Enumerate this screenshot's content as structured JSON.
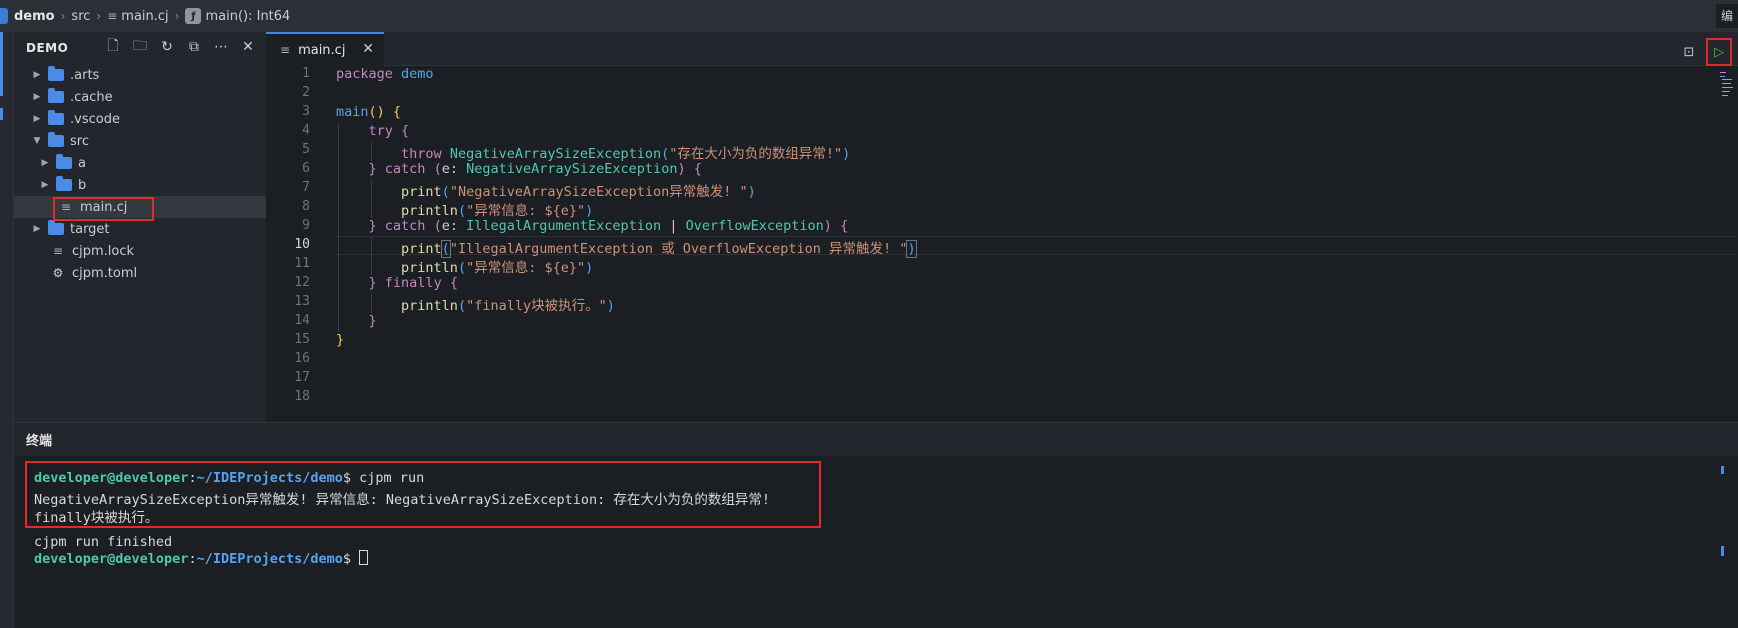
{
  "breadcrumb": {
    "project": "demo",
    "folder": "src",
    "file": "main.cj",
    "symbol": "main(): Int64",
    "right_cut": "编"
  },
  "sidebar": {
    "title": "DEMO",
    "items": [
      {
        "label": ".arts",
        "type": "folder",
        "depth": 0,
        "expanded": false
      },
      {
        "label": ".cache",
        "type": "folder",
        "depth": 0,
        "expanded": false
      },
      {
        "label": ".vscode",
        "type": "folder",
        "depth": 0,
        "expanded": false
      },
      {
        "label": "src",
        "type": "folder",
        "depth": 0,
        "expanded": true
      },
      {
        "label": "a",
        "type": "folder",
        "depth": 1,
        "expanded": false
      },
      {
        "label": "b",
        "type": "folder",
        "depth": 1,
        "expanded": false
      },
      {
        "label": "main.cj",
        "type": "file",
        "depth": 1,
        "selected": true
      },
      {
        "label": "target",
        "type": "folder",
        "depth": 0,
        "expanded": false
      },
      {
        "label": "cjpm.lock",
        "type": "file",
        "depth": 0
      },
      {
        "label": "cjpm.toml",
        "type": "config",
        "depth": 0
      }
    ]
  },
  "editor": {
    "tab_label": "main.cj",
    "active_line": 10,
    "line_numbers": [
      "1",
      "2",
      "3",
      "4",
      "5",
      "6",
      "7",
      "8",
      "9",
      "10",
      "11",
      "12",
      "13",
      "14",
      "15",
      "16",
      "17",
      "18"
    ]
  },
  "code": {
    "l1_kw": "package",
    "l1_name": "demo",
    "l3_fn": "main",
    "l4_kw": "try",
    "l5_kw": "throw",
    "l5_type": "NegativeArraySizeException",
    "l5_str": "\"存在大小为负的数组异常!\"",
    "l6_kw": "catch",
    "l6_var": "e",
    "l6_type": "NegativeArraySizeException",
    "l7_fn": "print",
    "l7_str": "\"NegativeArraySizeException异常触发! \"",
    "l8_fn": "println",
    "l8_str": "\"异常信息: ${e}\"",
    "l9_kw": "catch",
    "l9_var": "e",
    "l9_type1": "IllegalArgumentException",
    "l9_pipe": "|",
    "l9_type2": "OverflowException",
    "l10_fn": "print",
    "l10_str": "\"IllegalArgumentException 或 OverflowException 异常触发! \"",
    "l11_fn": "println",
    "l11_str": "\"异常信息: ${e}\"",
    "l12_kw": "finally",
    "l13_fn": "println",
    "l13_str": "\"finally块被执行。\""
  },
  "terminal": {
    "title": "终端",
    "user": "developer@developer",
    "path": "~/IDEProjects/demo",
    "prompt_symbol": "$",
    "command": "cjpm run",
    "output_line1": "NegativeArraySizeException异常触发! 异常信息: NegativeArraySizeException: 存在大小为负的数组异常!",
    "output_line2": "finally块被执行。",
    "finished": "cjpm run finished"
  },
  "colors": {
    "accent": "#3f86f0",
    "highlight_box": "#e02b2b",
    "run_icon": "#3fb950"
  }
}
